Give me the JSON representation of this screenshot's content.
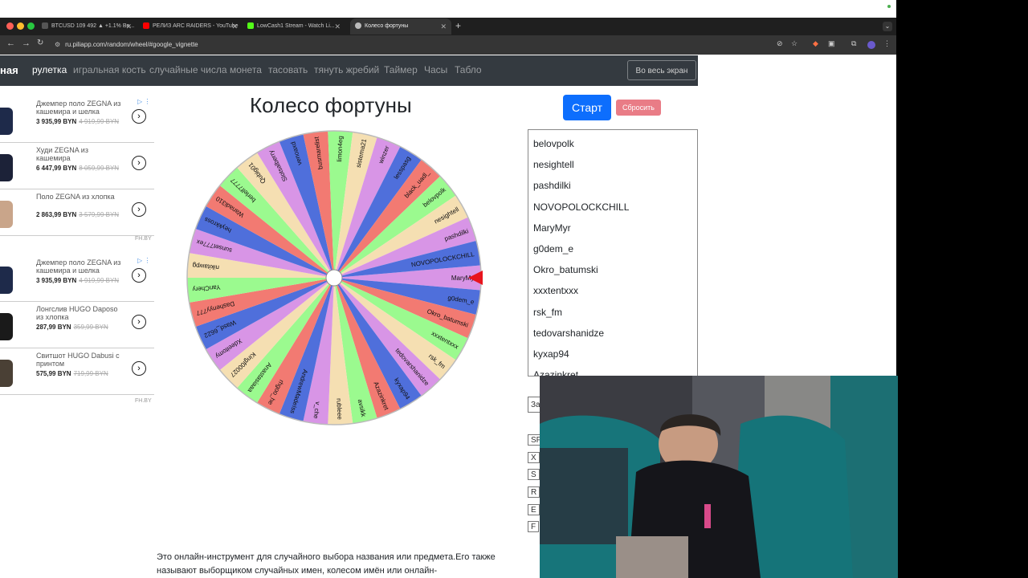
{
  "browser": {
    "tabs": [
      {
        "title": "BTCUSD 109 492 ▲ +1.1% Be...",
        "favicon_color": "#222222"
      },
      {
        "title": "РЕЛИЗ ARC RAIDERS - YouTube",
        "favicon_color": "#ff0000"
      },
      {
        "title": "LowCash1 Stream - Watch Li...",
        "favicon_color": "#53fc18"
      },
      {
        "title": "Колесо фортуны",
        "favicon_color": "#bbbbbb"
      }
    ],
    "url": "ru.piliapp.com/random/wheel/#google_vignette"
  },
  "site_nav": {
    "brand": "ная",
    "links": [
      "рулетка",
      "игральная кость",
      "случайные числа",
      "монета",
      "тасовать",
      "тянуть жребий",
      "Таймер",
      "Часы",
      "Табло"
    ],
    "fullscreen": "Во весь экран"
  },
  "ads": [
    {
      "title": "Джемпер поло ZEGNA из кашемира и шелка",
      "price": "3 935,99 BYN",
      "old_price": "4 919,99 BYN",
      "color": "#1e2a4a"
    },
    {
      "title": "Худи ZEGNA из кашемира",
      "price": "6 447,99 BYN",
      "old_price": "8 059,99 BYN",
      "color": "#1c2238"
    },
    {
      "title": "Поло ZEGNA из хлопка",
      "price": "2 863,99 BYN",
      "old_price": "3 579,99 BYN",
      "color": "#c9a58a"
    },
    {
      "title": "Джемпер поло ZEGNA из кашемира и шелка",
      "price": "3 935,99 BYN",
      "old_price": "4 919,99 BYN",
      "color": "#1e2a4a"
    },
    {
      "title": "Лонгслив HUGO Daposo из хлопка",
      "price": "287,99 BYN",
      "old_price": "359,99 BYN",
      "color": "#1a1a1a"
    },
    {
      "title": "Свитшот HUGO Dabusi с принтом",
      "price": "575,99 BYN",
      "old_price": "719,99 BYN",
      "color": "#4a4035"
    }
  ],
  "ad_source": "FH.BY",
  "main": {
    "title": "Колесо фортуны",
    "start": "Старт",
    "reset": "Сбросить"
  },
  "wheel": {
    "names": [
      "MaryMyr",
      "g0dem_e",
      "Okro_batumski",
      "xxxtentxxx",
      "rsk_fm",
      "tedovarshanidze",
      "kyxap94",
      "Azazinkret",
      "avsikk",
      "rubleee",
      "v_che",
      "AndrewMadeIss",
      "rhgoo_he",
      "Anastasiaaa",
      "Kingf00027",
      "Xdeeitomy",
      "Wasd_6622",
      "Dashenyy777",
      "YanChery",
      "nikitawpg",
      "sunset777ex",
      "heykkross",
      "Wanadi310",
      "berlelf7777",
      "Qubig01",
      "Slotsalberry",
      "venoaxd",
      "busmarelist",
      "limon4eg",
      "sistema21",
      "winzer",
      "lesspasg",
      "black_uadl_",
      "belovpolk",
      "nesightell",
      "pashdilki",
      "NOVOPOLOCKCHILL"
    ],
    "colors": [
      "#d895e6",
      "#4f6fdb",
      "#f27a72",
      "#9bfa8f",
      "#f5dfb2"
    ]
  },
  "names_list": [
    "belovpolk",
    "nesightell",
    "pashdilki",
    "NOVOPOLOCKCHILL",
    "MaryMyr",
    "g0dem_e",
    "Okro_batumski",
    "xxxtentxxx",
    "rsk_fm",
    "tedovarshanidze",
    "kyxap94",
    "Azazinkret"
  ],
  "side_stubs": [
    "За",
    "SF",
    "X",
    "S",
    "R",
    "E",
    "F"
  ],
  "description": "Это онлайн-инструмент для случайного выбора названия или предмета.Его также называют выборщиком случайных имен, колесом имён или онлайн-"
}
